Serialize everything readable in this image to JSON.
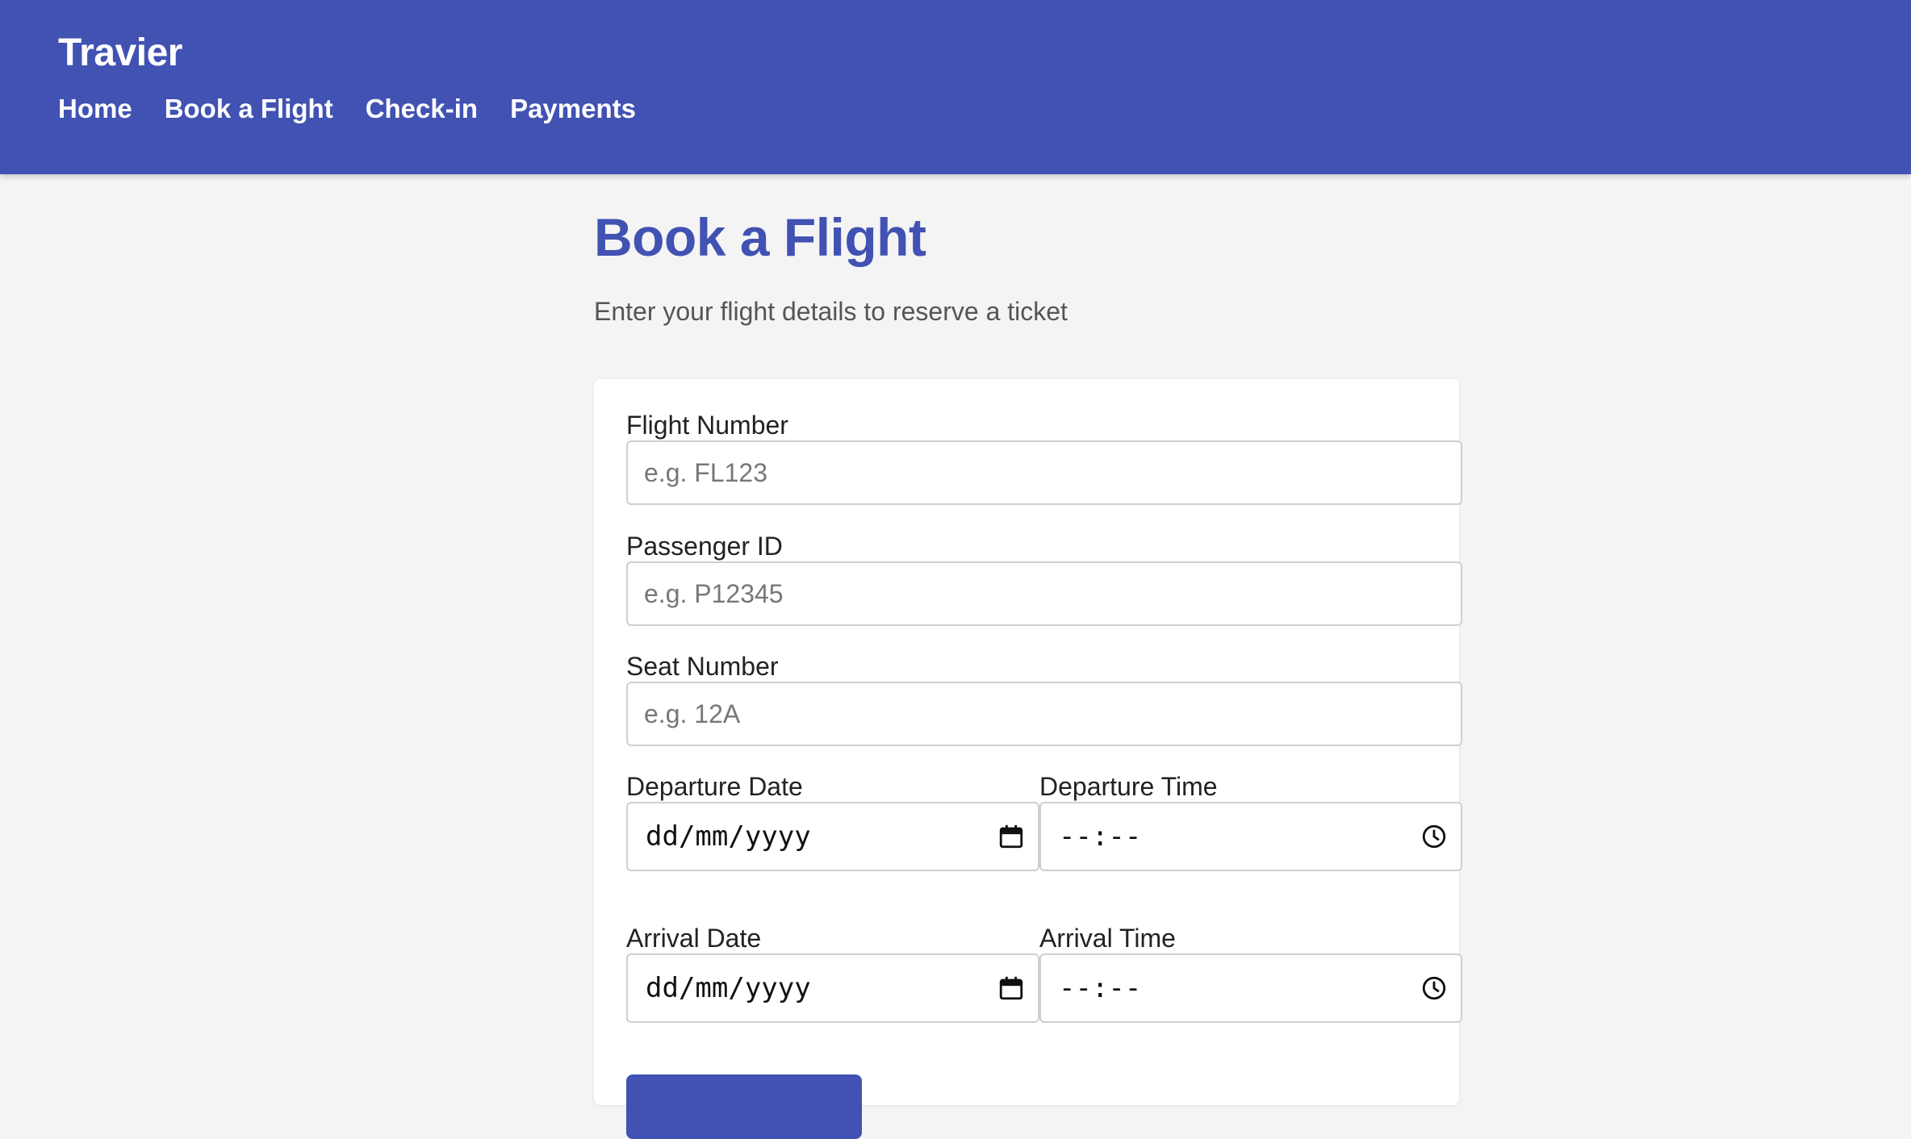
{
  "header": {
    "brand": "Travier",
    "nav": [
      {
        "label": "Home"
      },
      {
        "label": "Book a Flight"
      },
      {
        "label": "Check-in"
      },
      {
        "label": "Payments"
      }
    ]
  },
  "page": {
    "title": "Book a Flight",
    "subtitle": "Enter your flight details to reserve a ticket"
  },
  "form": {
    "flight_number": {
      "label": "Flight Number",
      "placeholder": "e.g. FL123",
      "value": ""
    },
    "passenger_id": {
      "label": "Passenger ID",
      "placeholder": "e.g. P12345",
      "value": ""
    },
    "seat_number": {
      "label": "Seat Number",
      "placeholder": "e.g. 12A",
      "value": ""
    },
    "departure_date": {
      "label": "Departure Date",
      "value": "dd/mm/yyyy"
    },
    "departure_time": {
      "label": "Departure Time",
      "value": "--:--"
    },
    "arrival_date": {
      "label": "Arrival Date",
      "value": "dd/mm/yyyy"
    },
    "arrival_time": {
      "label": "Arrival Time",
      "value": "--:--"
    }
  },
  "icons": {
    "date_picker": "calendar-icon",
    "time_picker": "clock-icon"
  },
  "colors": {
    "primary": "#4152b3",
    "background": "#f4f4f4",
    "card": "#ffffff"
  }
}
